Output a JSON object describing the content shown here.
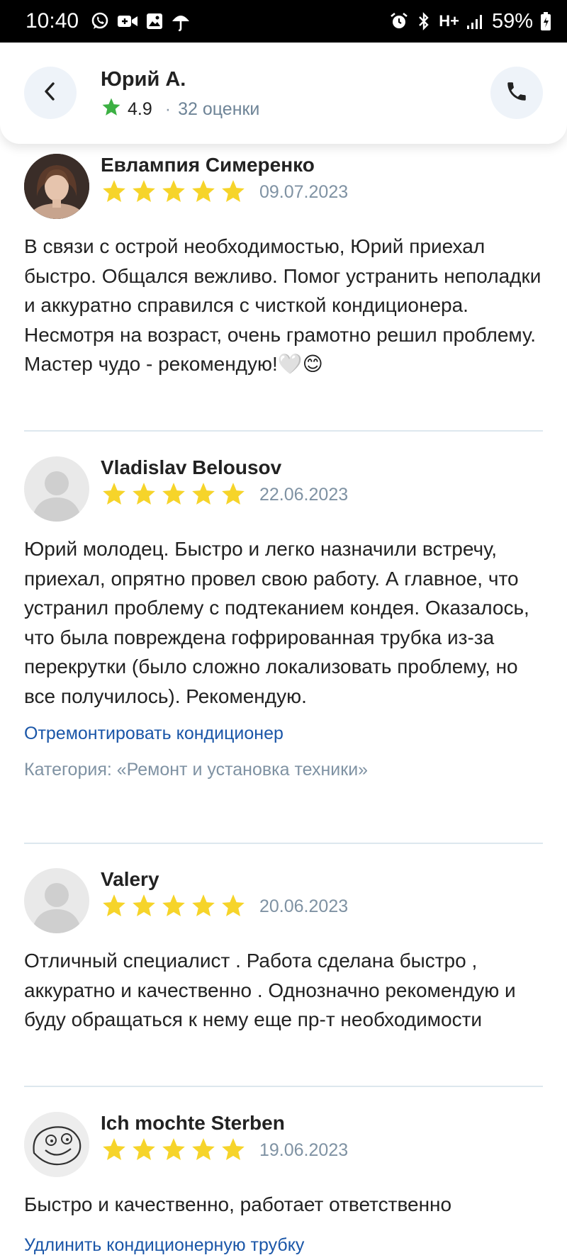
{
  "status_bar": {
    "time": "10:40",
    "network": "H+",
    "battery": "59%",
    "left_icons": [
      "whatsapp-icon",
      "video-call-icon",
      "gallery-icon",
      "umbrella-icon"
    ],
    "right_icons": [
      "alarm-icon",
      "bluetooth-icon",
      "signal-icon",
      "battery-icon"
    ]
  },
  "header": {
    "title": "Юрий А.",
    "rating": "4.9",
    "separator": "·",
    "rating_count": "32 оценки",
    "back_icon": "chevron-left-icon",
    "call_icon": "phone-icon"
  },
  "colors": {
    "star": "#f6d42a",
    "header_star": "#3cb043",
    "link": "#1a56a8",
    "muted": "#7f92a3",
    "divider": "#dde7ee",
    "button_bg": "#eef3f9"
  },
  "reviews": [
    {
      "author": "Евлампия Симеренко",
      "rating": 5,
      "date": "09.07.2023",
      "avatar": "photo",
      "text": "В связи с острой необходимостью, Юрий приехал быстро. Общался вежливо. Помог устранить неполадки и аккуратно справился с чисткой кондиционера. Несмотря на возраст, очень грамотно решил проблему. Мастер чудо - рекомендую!🤍😊"
    },
    {
      "author": "Vladislav Belousov",
      "rating": 5,
      "date": "22.06.2023",
      "avatar": "placeholder",
      "text": "Юрий молодец. Быстро и легко назначили встречу, приехал, опрятно провел свою работу. А главное, что устранил проблему с подтеканием кондея. Оказалось, что была повреждена гофрированная трубка из-за перекрутки (было сложно локализовать проблему, но все получилось). Рекомендую.",
      "service_link": "Отремонтировать кондиционер",
      "category": "Категория: «Ремонт и установка техники»"
    },
    {
      "author": "Valery",
      "rating": 5,
      "date": "20.06.2023",
      "avatar": "placeholder",
      "text": "Отличный специалист . Работа сделана быстро , аккуратно и качественно . Однозначно рекомендую и буду обращаться к нему еще пр-т необходимости"
    },
    {
      "author": "Ich mochte Sterben",
      "rating": 5,
      "date": "19.06.2023",
      "avatar": "drawing",
      "text": "Быстро и качественно, работает ответственно",
      "service_link": "Удлинить кондиционерную трубку"
    }
  ]
}
